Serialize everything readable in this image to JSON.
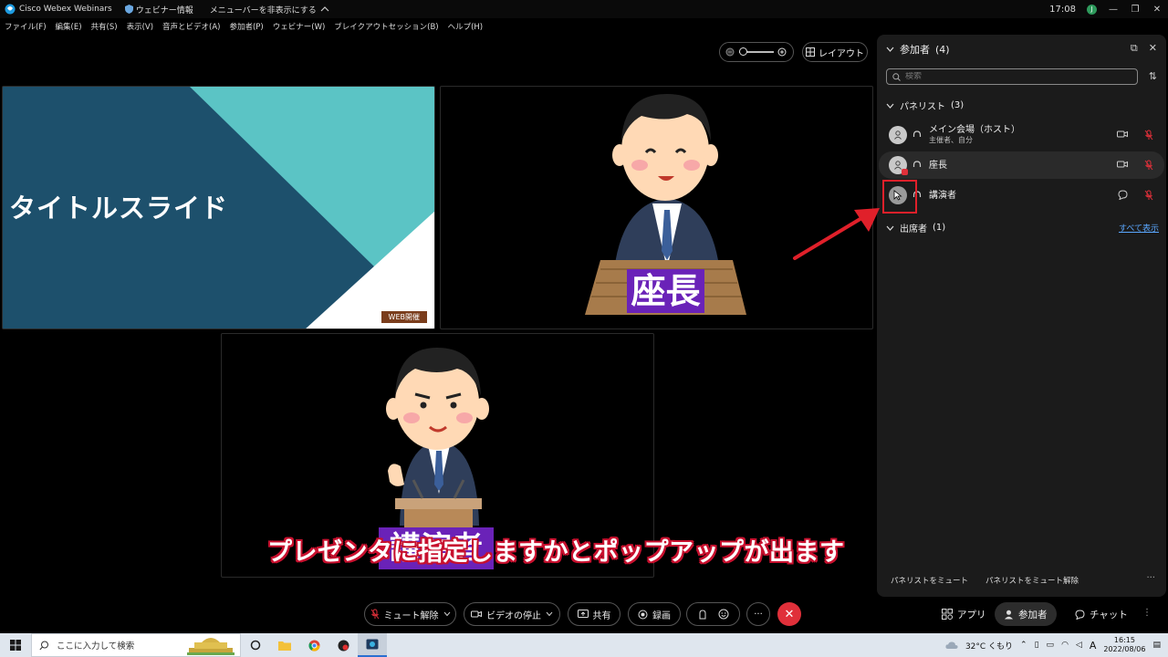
{
  "titlebar": {
    "app_title": "Cisco Webex Webinars",
    "info_label": "ウェビナー情報",
    "hide_menu_label": "メニューバーを非表示にする",
    "clock": "17:08",
    "avatar_initial": "J"
  },
  "menu": [
    "ファイル(F)",
    "編集(E)",
    "共有(S)",
    "表示(V)",
    "音声とビデオ(A)",
    "参加者(P)",
    "ウェビナー(W)",
    "ブレイクアウトセッション(B)",
    "ヘルプ(H)"
  ],
  "top_controls": {
    "layout_label": "レイアウト"
  },
  "slide": {
    "title": "タイトルスライド",
    "badge": "WEB開催"
  },
  "tiles": {
    "chair_plate": "座長",
    "speaker_plate": "講演者"
  },
  "panel": {
    "title": "参加者",
    "count": "(4)",
    "search_placeholder": "検索",
    "panelists_label": "パネリスト",
    "panelists_count": "(3)",
    "attendees_label": "出席者",
    "attendees_count": "(1)",
    "show_all": "すべて表示",
    "panelists": [
      {
        "name": "メイン会場（ホスト）",
        "sub": "主催者、自分"
      },
      {
        "name": "座長",
        "sub": ""
      },
      {
        "name": "講演者",
        "sub": ""
      }
    ],
    "mute_all": "パネリストをミュート",
    "unmute_all": "パネリストをミュート解除"
  },
  "controls": {
    "unmute": "ミュート解除",
    "stop_video": "ビデオの停止",
    "share": "共有",
    "record": "録画",
    "more": "···",
    "apps": "アプリ",
    "participants": "参加者",
    "chat": "チャット"
  },
  "caption": "プレゼンタに指定しますかとポップアップが出ます",
  "taskbar": {
    "search_placeholder": "ここに入力して検索",
    "weather": "32°C くもり",
    "time": "16:15",
    "date": "2022/08/06",
    "ime": "A"
  },
  "colors": {
    "panel_bg": "#1b1b1b",
    "accent_red": "#e0202a",
    "mute_red": "#e0303a",
    "link_blue": "#5aa7ff",
    "plate_purple": "#6a22b8",
    "slide_teal": "#5bc4c5",
    "slide_navy": "#1d506c"
  }
}
